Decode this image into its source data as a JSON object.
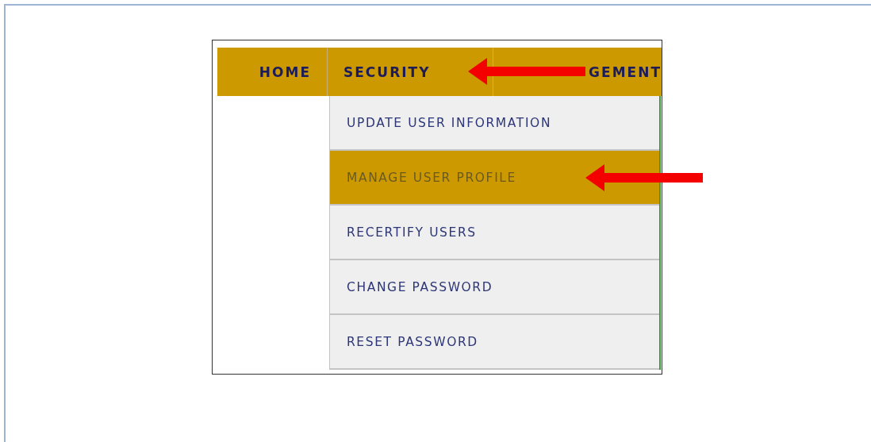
{
  "nav": [
    {
      "label": "HOME"
    },
    {
      "label": "SECURITY"
    },
    {
      "label": "GEMENT"
    }
  ],
  "menu": [
    {
      "label": "UPDATE USER INFORMATION",
      "selected": false
    },
    {
      "label": "MANAGE USER PROFILE",
      "selected": true
    },
    {
      "label": "RECERTIFY USERS",
      "selected": false
    },
    {
      "label": "CHANGE PASSWORD",
      "selected": false
    },
    {
      "label": "RESET PASSWORD",
      "selected": false
    }
  ]
}
